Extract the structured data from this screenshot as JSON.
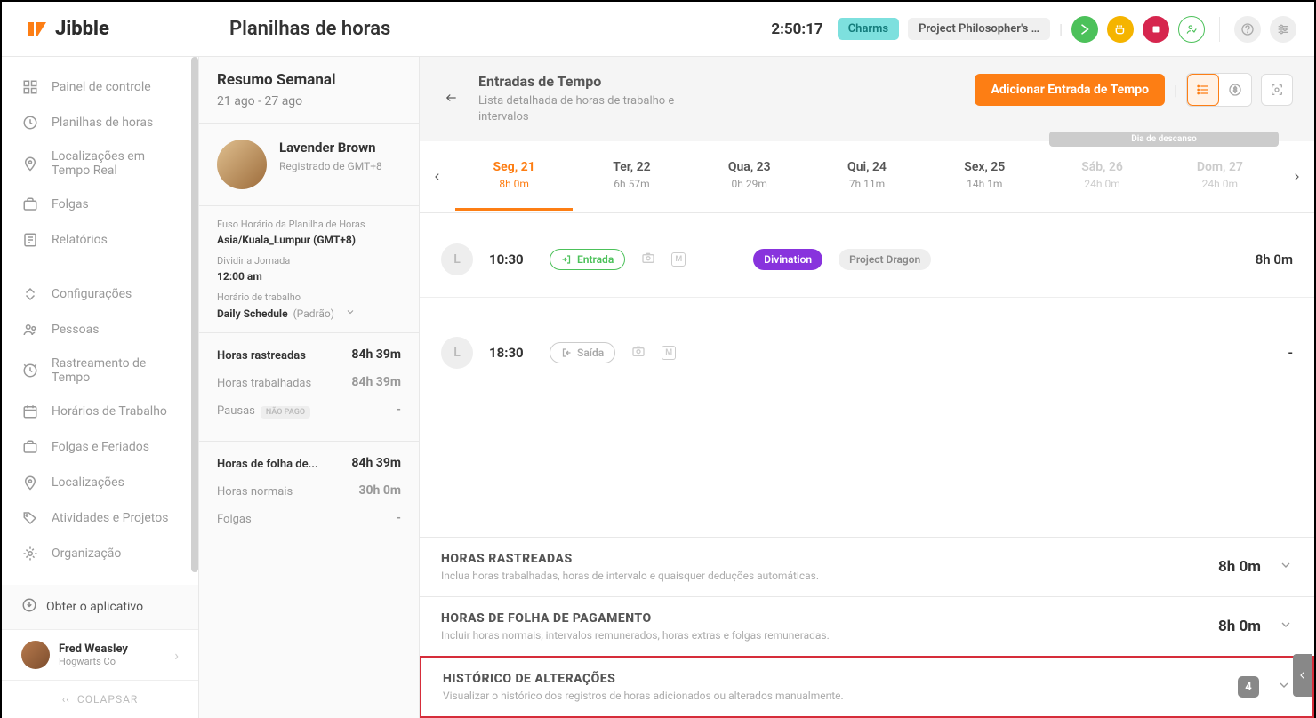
{
  "header": {
    "logo_text": "Jibble",
    "page_title": "Planilhas de horas",
    "timer": "2:50:17",
    "badge_charms": "Charms",
    "badge_project": "Project Philosopher's S…"
  },
  "sidebar": {
    "items": [
      {
        "label": "Painel de controle",
        "icon": "dashboard-icon"
      },
      {
        "label": "Planilhas de horas",
        "icon": "clock-icon"
      },
      {
        "label": "Localizações em Tempo Real",
        "icon": "pin-icon"
      },
      {
        "label": "Folgas",
        "icon": "briefcase-icon"
      },
      {
        "label": "Relatórios",
        "icon": "report-icon"
      }
    ],
    "items2": [
      {
        "label": "Configurações",
        "icon": "settings-chevrons-icon"
      },
      {
        "label": "Pessoas",
        "icon": "people-icon"
      },
      {
        "label": "Rastreamento de Tempo",
        "icon": "tracking-icon"
      },
      {
        "label": "Horários de Trabalho",
        "icon": "schedule-icon"
      },
      {
        "label": "Folgas e Feriados",
        "icon": "holiday-icon"
      },
      {
        "label": "Localizações",
        "icon": "pin-icon"
      },
      {
        "label": "Atividades e Projetos",
        "icon": "tag-icon"
      },
      {
        "label": "Organização",
        "icon": "gear-icon"
      }
    ],
    "get_app": "Obter o aplicativo",
    "user_name": "Fred Weasley",
    "user_sub": "Hogwarts Co",
    "collapse": "COLAPSAR"
  },
  "summary": {
    "title": "Resumo Semanal",
    "range": "21 ago - 27 ago",
    "person_name": "Lavender Brown",
    "person_sub": "Registrado de GMT+8",
    "tz_label": "Fuso Horário da Planilha de Horas",
    "tz_value": "Asia/Kuala_Lumpur (GMT+8)",
    "split_label": "Dividir a Jornada",
    "split_value": "12:00 am",
    "work_label": "Horário de trabalho",
    "schedule_name": "Daily Schedule",
    "schedule_default": "(Padrão)",
    "stats1": [
      {
        "label": "Horas rastreadas",
        "value": "84h 39m",
        "bold": true
      },
      {
        "label": "Horas trabalhadas",
        "value": "84h 39m"
      },
      {
        "label": "Pausas",
        "value": "-",
        "unpaid": "NÃO PAGO"
      }
    ],
    "stats2": [
      {
        "label": "Horas de folha de...",
        "value": "84h 39m",
        "bold": true
      },
      {
        "label": "Horas normais",
        "value": "30h 0m"
      },
      {
        "label": "Folgas",
        "value": "-"
      }
    ]
  },
  "main": {
    "head_title": "Entradas de Tempo",
    "head_sub": "Lista detalhada de horas de trabalho e intervalos",
    "add_button": "Adicionar Entrada de Tempo",
    "rest_day_label": "Dia de descanso",
    "days": [
      {
        "label": "Seg, 21",
        "dur": "8h 0m",
        "active": true
      },
      {
        "label": "Ter, 22",
        "dur": "6h 57m"
      },
      {
        "label": "Qua, 23",
        "dur": "0h 29m"
      },
      {
        "label": "Qui, 24",
        "dur": "7h 11m"
      },
      {
        "label": "Sex, 25",
        "dur": "14h 1m"
      },
      {
        "label": "Sáb, 26",
        "dur": "24h 0m",
        "off": true
      },
      {
        "label": "Dom, 27",
        "dur": "24h 0m",
        "off": true
      }
    ],
    "entries": [
      {
        "avatar_letter": "L",
        "time": "10:30",
        "type": "Entrada",
        "in": true,
        "tag_activity": "Divination",
        "tag_project": "Project Dragon",
        "duration": "8h 0m"
      },
      {
        "avatar_letter": "L",
        "time": "18:30",
        "type": "Saída",
        "in": false,
        "duration": "-"
      }
    ],
    "accordions": [
      {
        "title": "HORAS RASTREADAS",
        "sub": "Inclua horas trabalhadas, horas de intervalo e quaisquer deduções automáticas.",
        "value": "8h 0m"
      },
      {
        "title": "HORAS DE FOLHA DE PAGAMENTO",
        "sub": "Incluir horas normais, intervalos remunerados, horas extras e folgas remuneradas.",
        "value": "8h 0m"
      },
      {
        "title": "HISTÓRICO DE ALTERAÇÕES",
        "sub": "Visualizar o histórico dos registros de horas adicionados ou alterados manualmente.",
        "count": "4",
        "highlight": true
      }
    ]
  }
}
